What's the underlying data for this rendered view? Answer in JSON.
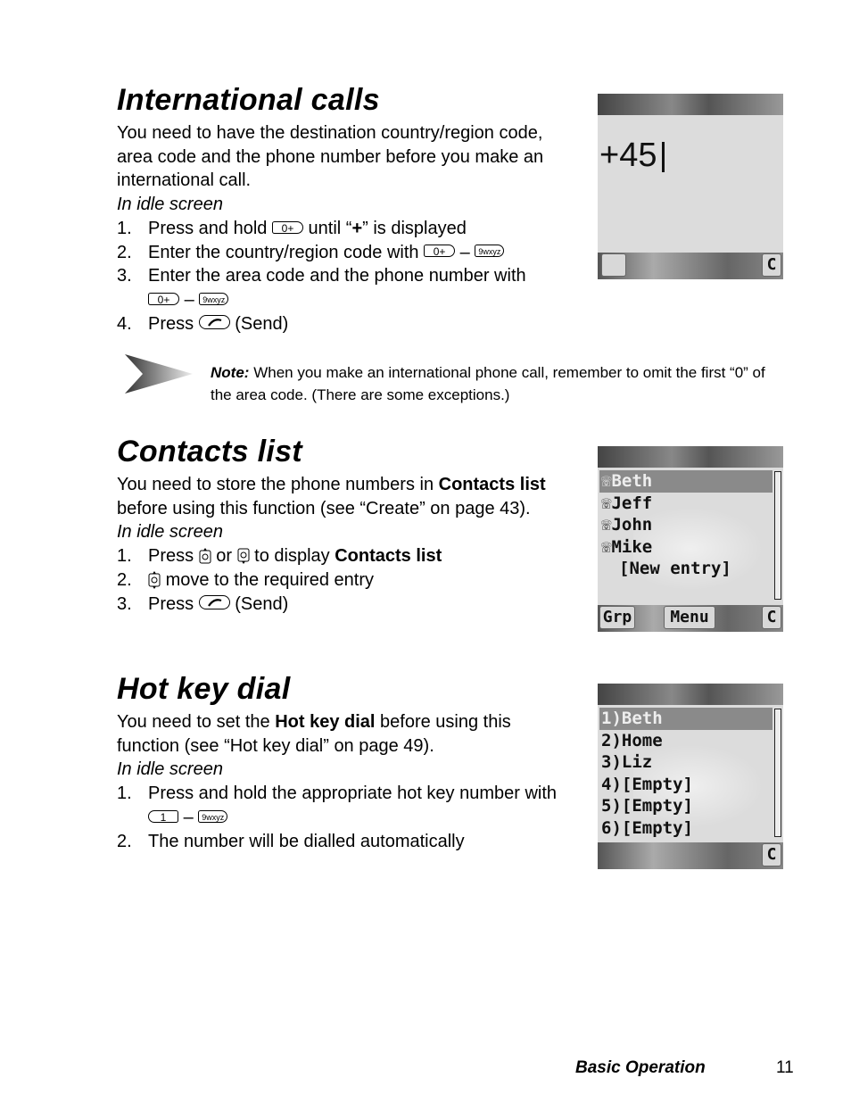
{
  "international": {
    "title": "International calls",
    "intro": "You need to have the destination country/region code, area code and the phone number before you make an international call.",
    "context": "In idle screen",
    "steps": [
      {
        "num": "1.",
        "a": "Press and hold",
        "b": "until “",
        "plus": "+",
        "c": "” is displayed"
      },
      {
        "num": "2.",
        "a": "Enter the country/region code with",
        "dash": "–"
      },
      {
        "num": "3.",
        "a": "Enter the area code and the phone number with",
        "dash": "–"
      },
      {
        "num": "4.",
        "a": "Press",
        "b": "(Send)"
      }
    ],
    "screen": {
      "display": "+45",
      "soft_right": "C"
    }
  },
  "note": {
    "label": "Note:",
    "text": "When you make an international phone call, remember to omit the first “0” of the area code. (There are some exceptions.)"
  },
  "contacts": {
    "title": "Contacts list",
    "intro_a": "You need to store the phone numbers in",
    "intro_bold": "Contacts list",
    "intro_b": "before using this function (see “Create” on page 43).",
    "context": "In idle screen",
    "steps": [
      {
        "num": "1.",
        "a": "Press",
        "or": "or",
        "b": "to display",
        "bold": "Contacts list"
      },
      {
        "num": "2.",
        "a": "move to the required entry"
      },
      {
        "num": "3.",
        "a": "Press",
        "b": "(Send)"
      }
    ],
    "screen": {
      "entries": [
        "Beth",
        "Jeff",
        "John",
        "Mike"
      ],
      "new_entry": "[New entry]",
      "soft_left": "Grp",
      "soft_mid": "Menu",
      "soft_right": "C"
    }
  },
  "hotkey": {
    "title": "Hot key dial",
    "intro_a": "You need to set the",
    "intro_bold": "Hot key dial",
    "intro_b": "before using this function (see “Hot key dial” on page 49).",
    "context": "In idle screen",
    "steps": [
      {
        "num": "1.",
        "a": "Press and hold the appropriate hot key number with",
        "dash": "–"
      },
      {
        "num": "2.",
        "a": "The number will be dialled automatically"
      }
    ],
    "screen": {
      "entries": [
        "1)Beth",
        "2)Home",
        "3)Liz",
        "4)[Empty]",
        "5)[Empty]",
        "6)[Empty]"
      ],
      "soft_right": "C"
    }
  },
  "keys": {
    "zero": "0+",
    "nine": "9wxyz",
    "one": "1"
  },
  "footer": {
    "section": "Basic Operation",
    "page": "11"
  }
}
